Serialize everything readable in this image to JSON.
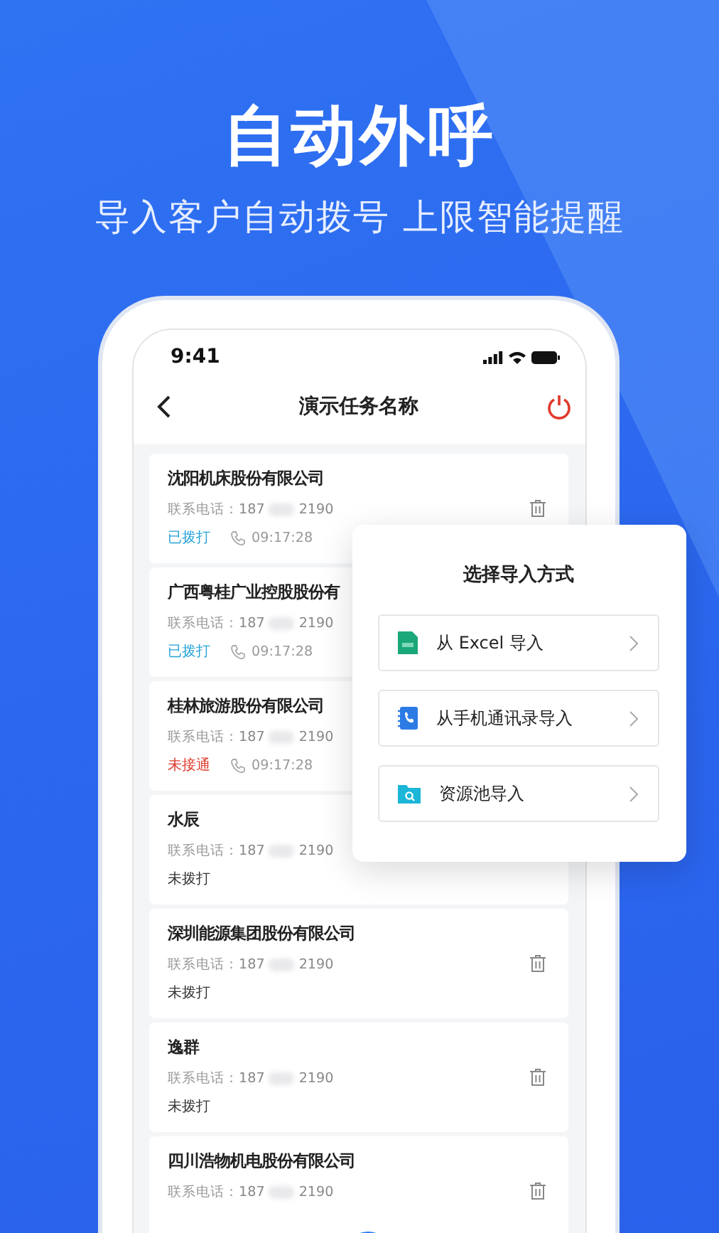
{
  "headline": "自动外呼",
  "subheadline": "导入客户自动拨号 上限智能提醒",
  "status_bar": {
    "time": "9:41"
  },
  "nav": {
    "title": "演示任务名称"
  },
  "contacts": [
    {
      "name": "沈阳机床股份有限公司",
      "phone_label": "联系电话：",
      "phone_start": "187",
      "phone_end": "2190",
      "status": "已拨打",
      "kind": "called",
      "time": "09:17:28"
    },
    {
      "name": "广西粤桂广业控股股份有",
      "phone_label": "联系电话：",
      "phone_start": "187",
      "phone_end": "2190",
      "status": "已拨打",
      "kind": "called",
      "time": "09:17:28"
    },
    {
      "name": "桂林旅游股份有限公司",
      "phone_label": "联系电话：",
      "phone_start": "187",
      "phone_end": "2190",
      "status": "未接通",
      "kind": "failed",
      "time": "09:17:28"
    },
    {
      "name": "水辰",
      "phone_label": "联系电话：",
      "phone_start": "187",
      "phone_end": "2190",
      "status": "未拨打",
      "kind": "pending"
    },
    {
      "name": "深圳能源集团股份有限公司",
      "phone_label": "联系电话：",
      "phone_start": "187",
      "phone_end": "2190",
      "status": "未拨打",
      "kind": "pending"
    },
    {
      "name": "逸群",
      "phone_label": "联系电话：",
      "phone_start": "187",
      "phone_end": "2190",
      "status": "未拨打",
      "kind": "pending"
    },
    {
      "name": "四川浩物机电股份有限公司",
      "phone_label": "联系电话：",
      "phone_start": "187",
      "phone_end": "2190"
    }
  ],
  "import_dialog": {
    "title": "选择导入方式",
    "options": [
      {
        "label": "从 Excel 导入",
        "kind": "excel"
      },
      {
        "label": "从手机通讯录导入",
        "kind": "contacts"
      },
      {
        "label": "资源池导入",
        "kind": "pool"
      }
    ]
  }
}
